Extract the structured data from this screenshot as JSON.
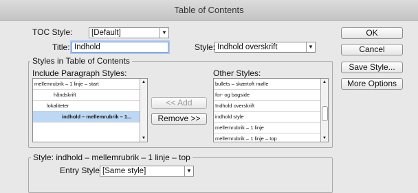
{
  "window": {
    "title": "Table of Contents"
  },
  "toc_style": {
    "label": "TOC Style:",
    "value": "[Default]"
  },
  "title_field": {
    "label": "Title:",
    "value": "Indhold"
  },
  "title_style": {
    "label": "Style:",
    "value": "Indhold overskrift"
  },
  "styles_group": {
    "title": "Styles in Table of Contents",
    "include_label": "Include Paragraph Styles:",
    "other_label": "Other Styles:",
    "include_items": [
      {
        "label": "mellemrubrik – 1 linje – start"
      },
      {
        "label": "håndskrift"
      },
      {
        "label": "lokaliteter"
      },
      {
        "label": "indhold – mellemrubrik – 1..."
      }
    ],
    "other_items": [
      {
        "label": "bullets – skærtoft mølle"
      },
      {
        "label": "for- og bagside"
      },
      {
        "label": "Indhold overskrift"
      },
      {
        "label": "indhold style"
      },
      {
        "label": "mellemrubrik – 1 linje"
      },
      {
        "label": "mellemrubrik – 1 linje – top"
      }
    ],
    "add_label": "<< Add",
    "remove_label": "Remove >>"
  },
  "style_group": {
    "title": "Style: indhold – mellemrubrik – 1 linje – top",
    "entry_label": "Entry Style:",
    "entry_value": "[Same style]"
  },
  "buttons": {
    "ok": "OK",
    "cancel": "Cancel",
    "save_style": "Save Style...",
    "more_options": "More Options"
  },
  "colors": {
    "selection": "#bcd8f4",
    "focus_ring": "#a9c8f2"
  }
}
